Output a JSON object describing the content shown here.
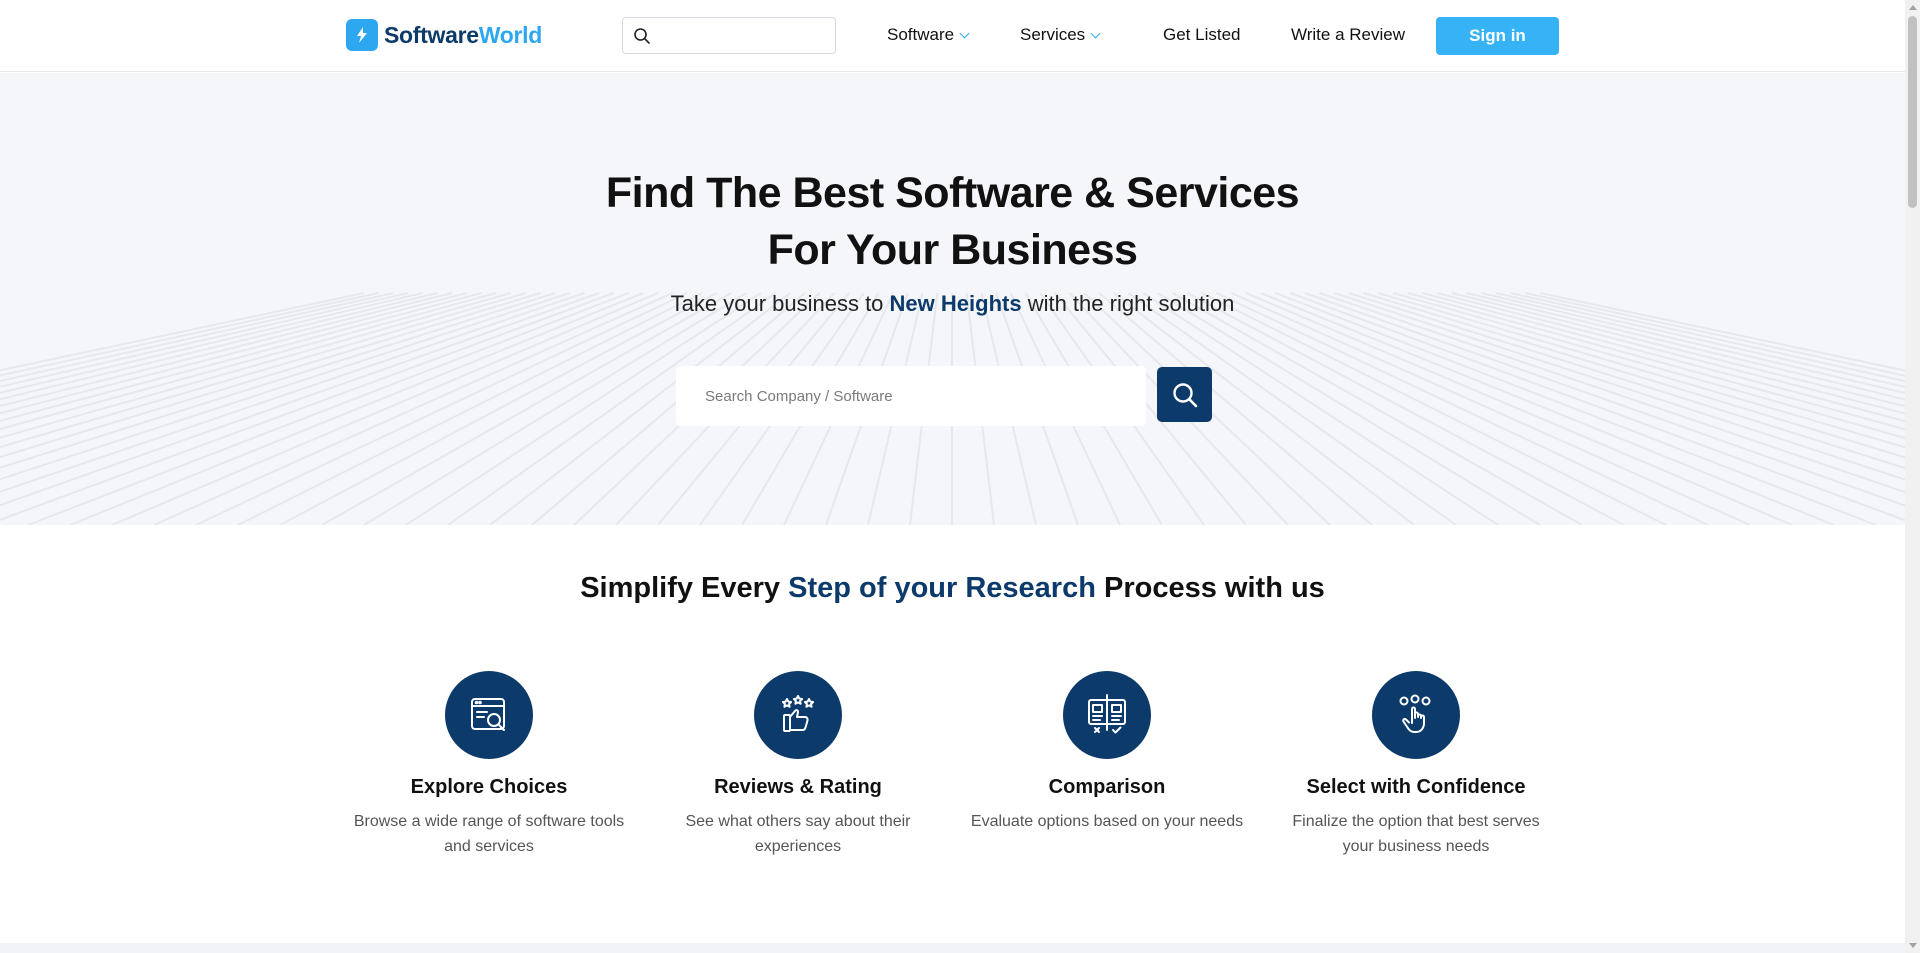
{
  "header": {
    "logo": {
      "part1": "Software",
      "part2": "World"
    },
    "search_placeholder": "",
    "nav": [
      {
        "label": "Software",
        "has_dropdown": true
      },
      {
        "label": "Services",
        "has_dropdown": true
      },
      {
        "label": "Get Listed",
        "has_dropdown": false
      },
      {
        "label": "Write a Review",
        "has_dropdown": false
      }
    ],
    "signin_label": "Sign in"
  },
  "hero": {
    "title_line1": "Find The Best Software & Services",
    "title_line2": "For Your Business",
    "subtitle_pre": "Take your business to ",
    "subtitle_highlight": "New Heights",
    "subtitle_post": " with the right solution",
    "search_placeholder": "Search Company / Software"
  },
  "research": {
    "title_pre": "Simplify Every ",
    "title_highlight": "Step of your Research",
    "title_post": " Process with us",
    "features": [
      {
        "icon": "browser-search-icon",
        "title": "Explore Choices",
        "desc": "Browse a wide range of software tools and services"
      },
      {
        "icon": "thumbs-up-stars-icon",
        "title": "Reviews & Rating",
        "desc": "See what others say about their experiences"
      },
      {
        "icon": "comparison-icon",
        "title": "Comparison",
        "desc": "Evaluate options based on your needs"
      },
      {
        "icon": "hand-select-icon",
        "title": "Select with Confidence",
        "desc": "Finalize the option that best serves your business needs"
      }
    ]
  },
  "colors": {
    "brand_dark": "#0c3a6b",
    "brand_light": "#2da8f0",
    "button_blue": "#36b3f6",
    "hero_bg": "#f5f6f9"
  }
}
